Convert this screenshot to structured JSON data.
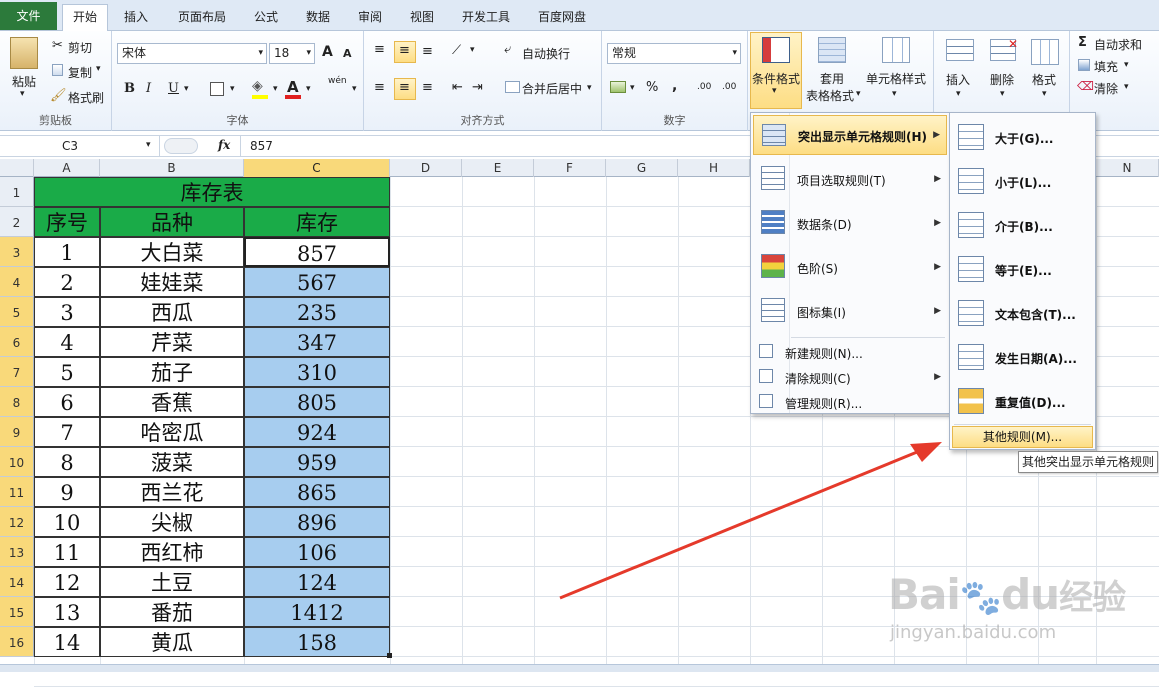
{
  "tabs": {
    "file": "文件",
    "home": "开始",
    "insert": "插入",
    "layout": "页面布局",
    "formula": "公式",
    "data": "数据",
    "review": "审阅",
    "view": "视图",
    "dev": "开发工具",
    "baidu": "百度网盘"
  },
  "ribbon": {
    "clipboard": {
      "label": "剪贴板",
      "paste": "粘贴",
      "cut": "剪切",
      "copy": "复制",
      "format_painter": "格式刷"
    },
    "font": {
      "label": "字体",
      "name": "宋体",
      "size": "18",
      "bold": "B",
      "italic": "I",
      "underline": "U",
      "grow": "A",
      "shrink": "A",
      "wen": "wén"
    },
    "align": {
      "label": "对齐方式",
      "wrap": "自动换行",
      "merge": "合并后居中"
    },
    "number": {
      "label": "数字",
      "format": "常规",
      "percent": "%",
      "comma": ",",
      "inc": ".00",
      "dec": ".00"
    },
    "styles": {
      "cond_format": "条件格式",
      "table_format_1": "套用",
      "table_format_2": "表格格式",
      "cell_style": "单元格样式"
    },
    "cells": {
      "insert": "插入",
      "delete": "删除",
      "format": "格式"
    },
    "editing": {
      "autosum": "自动求和",
      "fill": "填充",
      "clear": "清除"
    }
  },
  "formula_bar": {
    "name_box": "C3",
    "fx": "fx",
    "value": "857"
  },
  "columns": [
    "A",
    "B",
    "C",
    "D",
    "E",
    "F",
    "G",
    "H",
    "N"
  ],
  "sheet": {
    "title": "库存表",
    "headers": [
      "序号",
      "品种",
      "库存"
    ],
    "rows": [
      [
        "1",
        "大白菜",
        "857"
      ],
      [
        "2",
        "娃娃菜",
        "567"
      ],
      [
        "3",
        "西瓜",
        "235"
      ],
      [
        "4",
        "芹菜",
        "347"
      ],
      [
        "5",
        "茄子",
        "310"
      ],
      [
        "6",
        "香蕉",
        "805"
      ],
      [
        "7",
        "哈密瓜",
        "924"
      ],
      [
        "8",
        "菠菜",
        "959"
      ],
      [
        "9",
        "西兰花",
        "865"
      ],
      [
        "10",
        "尖椒",
        "896"
      ],
      [
        "11",
        "西红柿",
        "106"
      ],
      [
        "12",
        "土豆",
        "124"
      ],
      [
        "13",
        "番茄",
        "1412"
      ],
      [
        "14",
        "黄瓜",
        "158"
      ]
    ],
    "row_numbers": [
      "1",
      "2",
      "3",
      "4",
      "5",
      "6",
      "7",
      "8",
      "9",
      "10",
      "11",
      "12",
      "13",
      "14",
      "15",
      "16"
    ]
  },
  "cf_menu": {
    "items": [
      "突出显示单元格规则(H)",
      "项目选取规则(T)",
      "数据条(D)",
      "色阶(S)",
      "图标集(I)"
    ],
    "actions": [
      "新建规则(N)...",
      "清除规则(C)",
      "管理规则(R)..."
    ]
  },
  "sub_menu": {
    "items": [
      "大于(G)...",
      "小于(L)...",
      "介于(B)...",
      "等于(E)...",
      "文本包含(T)...",
      "发生日期(A)...",
      "重复值(D)..."
    ],
    "more": "其他规则(M)...",
    "tooltip": "其他突出显示单元格规则"
  },
  "watermark": {
    "brand": "Bai",
    "brand2": "du",
    "cn": "经验",
    "url": "jingyan.baidu.com"
  },
  "colors": {
    "header_green": "#1aab48",
    "selection_blue": "#a7cdef",
    "arrow_red": "#e53a2b",
    "file_tab": "#2c7a3b"
  }
}
